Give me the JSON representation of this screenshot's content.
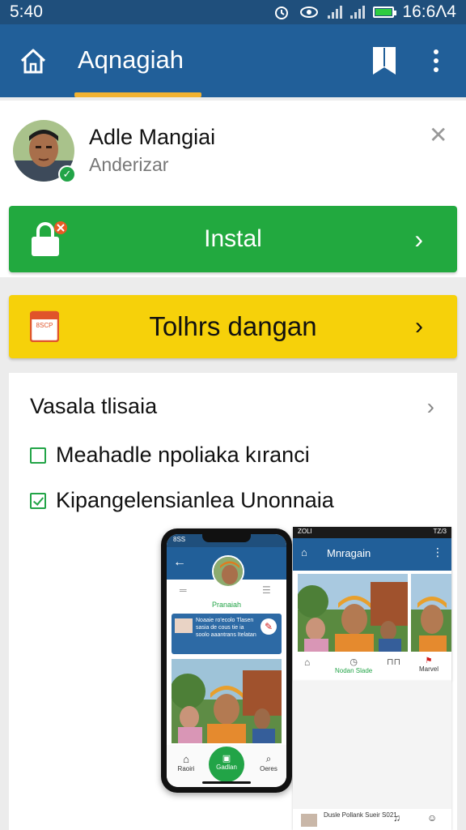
{
  "status_bar": {
    "time_left": "5:40",
    "time_right": "16:6Λ4"
  },
  "app_bar": {
    "title": "Aqnagiah"
  },
  "profile": {
    "name": "Adle Mangiai",
    "subtitle": "Anderizar"
  },
  "install_button": {
    "label": "Instal"
  },
  "yellow_button": {
    "label": "Tolhrs dangan",
    "calendar_text": "8SCP"
  },
  "card": {
    "heading": "Vasala tlisaia",
    "items": [
      {
        "label": "Meahadle npoliaka kıranci",
        "checked": false
      },
      {
        "label": "Kipangelensianlea Unonnaia",
        "checked": true
      }
    ]
  },
  "phone_mockup": {
    "status": "8SS",
    "profile_name": "Pranaiah",
    "card_text": "Noaaie ro'ecolo Tlasen sasia de cous tie ia soolo aaantrans Itelatan",
    "tabs": [
      "Raoiri",
      "Gadlan",
      "Oeres"
    ]
  },
  "tablet_mockup": {
    "status_left": "ZOLI",
    "status_right": "TZ/3",
    "title": "Mnragain",
    "tab_center": "Nodan Slade",
    "tab_right": "Marvel"
  },
  "tablet_bottom": {
    "text": "Dusle Pollank Sueir S021"
  }
}
